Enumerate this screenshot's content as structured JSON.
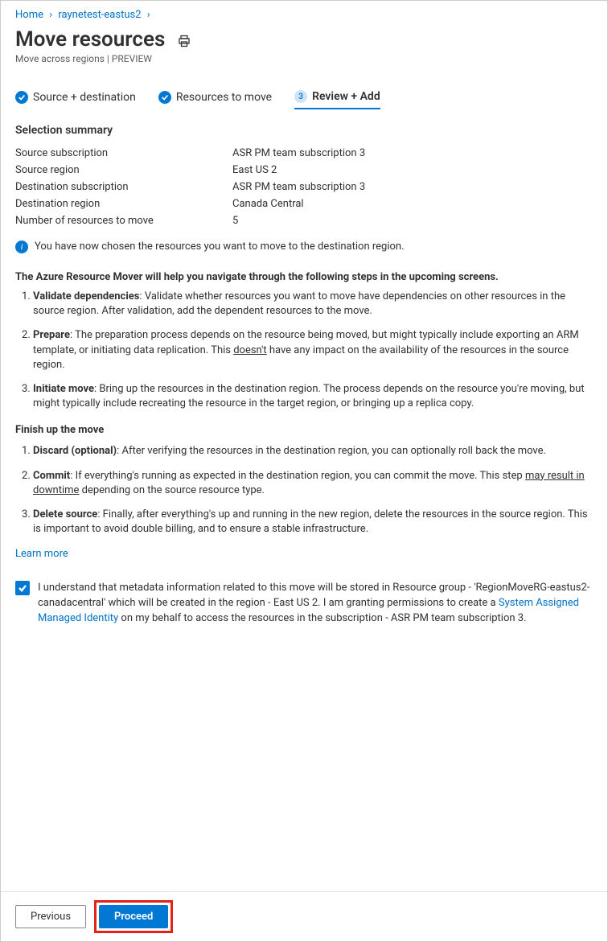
{
  "breadcrumb": {
    "home": "Home",
    "item": "raynetest-eastus2"
  },
  "title": "Move resources",
  "subtitle": "Move across regions | PREVIEW",
  "steps": {
    "s1": "Source + destination",
    "s2": "Resources to move",
    "s3_num": "3",
    "s3": "Review + Add"
  },
  "summary": {
    "heading": "Selection summary",
    "rows": {
      "src_sub_k": "Source subscription",
      "src_sub_v": "ASR PM team subscription 3",
      "src_reg_k": "Source region",
      "src_reg_v": "East US 2",
      "dst_sub_k": "Destination subscription",
      "dst_sub_v": "ASR PM team subscription 3",
      "dst_reg_k": "Destination region",
      "dst_reg_v": "Canada Central",
      "count_k": "Number of resources to move",
      "count_v": "5"
    }
  },
  "info_text": "You have now chosen the resources you want to move to the destination region.",
  "lead": "The Azure Resource Mover will help you navigate through the following steps in the upcoming screens.",
  "major_steps": {
    "s1_b": "Validate dependencies",
    "s1_t": ": Validate whether resources you want to move have dependencies on other resources in the source region. After validation, add the dependent resources to the move.",
    "s2_b": "Prepare",
    "s2_t1": ": The preparation process depends on the resource being moved, but might typically include exporting an ARM template, or initiating data replication. This ",
    "s2_u": "doesn't",
    "s2_t2": " have any impact on the availability of the resources in the source region.",
    "s3_b": "Initiate move",
    "s3_t": ": Bring up the resources in the destination region. The process depends on the resource you're moving, but might typically include recreating the resource in the target region, or bringing up a replica copy."
  },
  "finish_heading": "Finish up the move",
  "finish_steps": {
    "f1_b": "Discard (optional)",
    "f1_t": ": After verifying the resources in the destination region, you can optionally roll back the move.",
    "f2_b": "Commit",
    "f2_t1": ": If everything's running as expected in the destination region, you can commit the move. This step ",
    "f2_u": "may result in downtime",
    "f2_t2": " depending on the source resource type.",
    "f3_b": "Delete source",
    "f3_t": ": Finally, after everything's up and running in the new region, delete the resources in the source region. This is important to avoid double billing, and to ensure a stable infrastructure."
  },
  "learn_more": "Learn more",
  "consent": {
    "t1": "I understand that metadata information related to this move will be stored in Resource group - 'RegionMoveRG-eastus2-canadacentral' which will be created in the region - East US 2. I am granting permissions to create a ",
    "link": "System Assigned Managed Identity",
    "t2": " on my behalf to access the resources in the subscription - ASR PM team subscription 3."
  },
  "buttons": {
    "previous": "Previous",
    "proceed": "Proceed"
  }
}
